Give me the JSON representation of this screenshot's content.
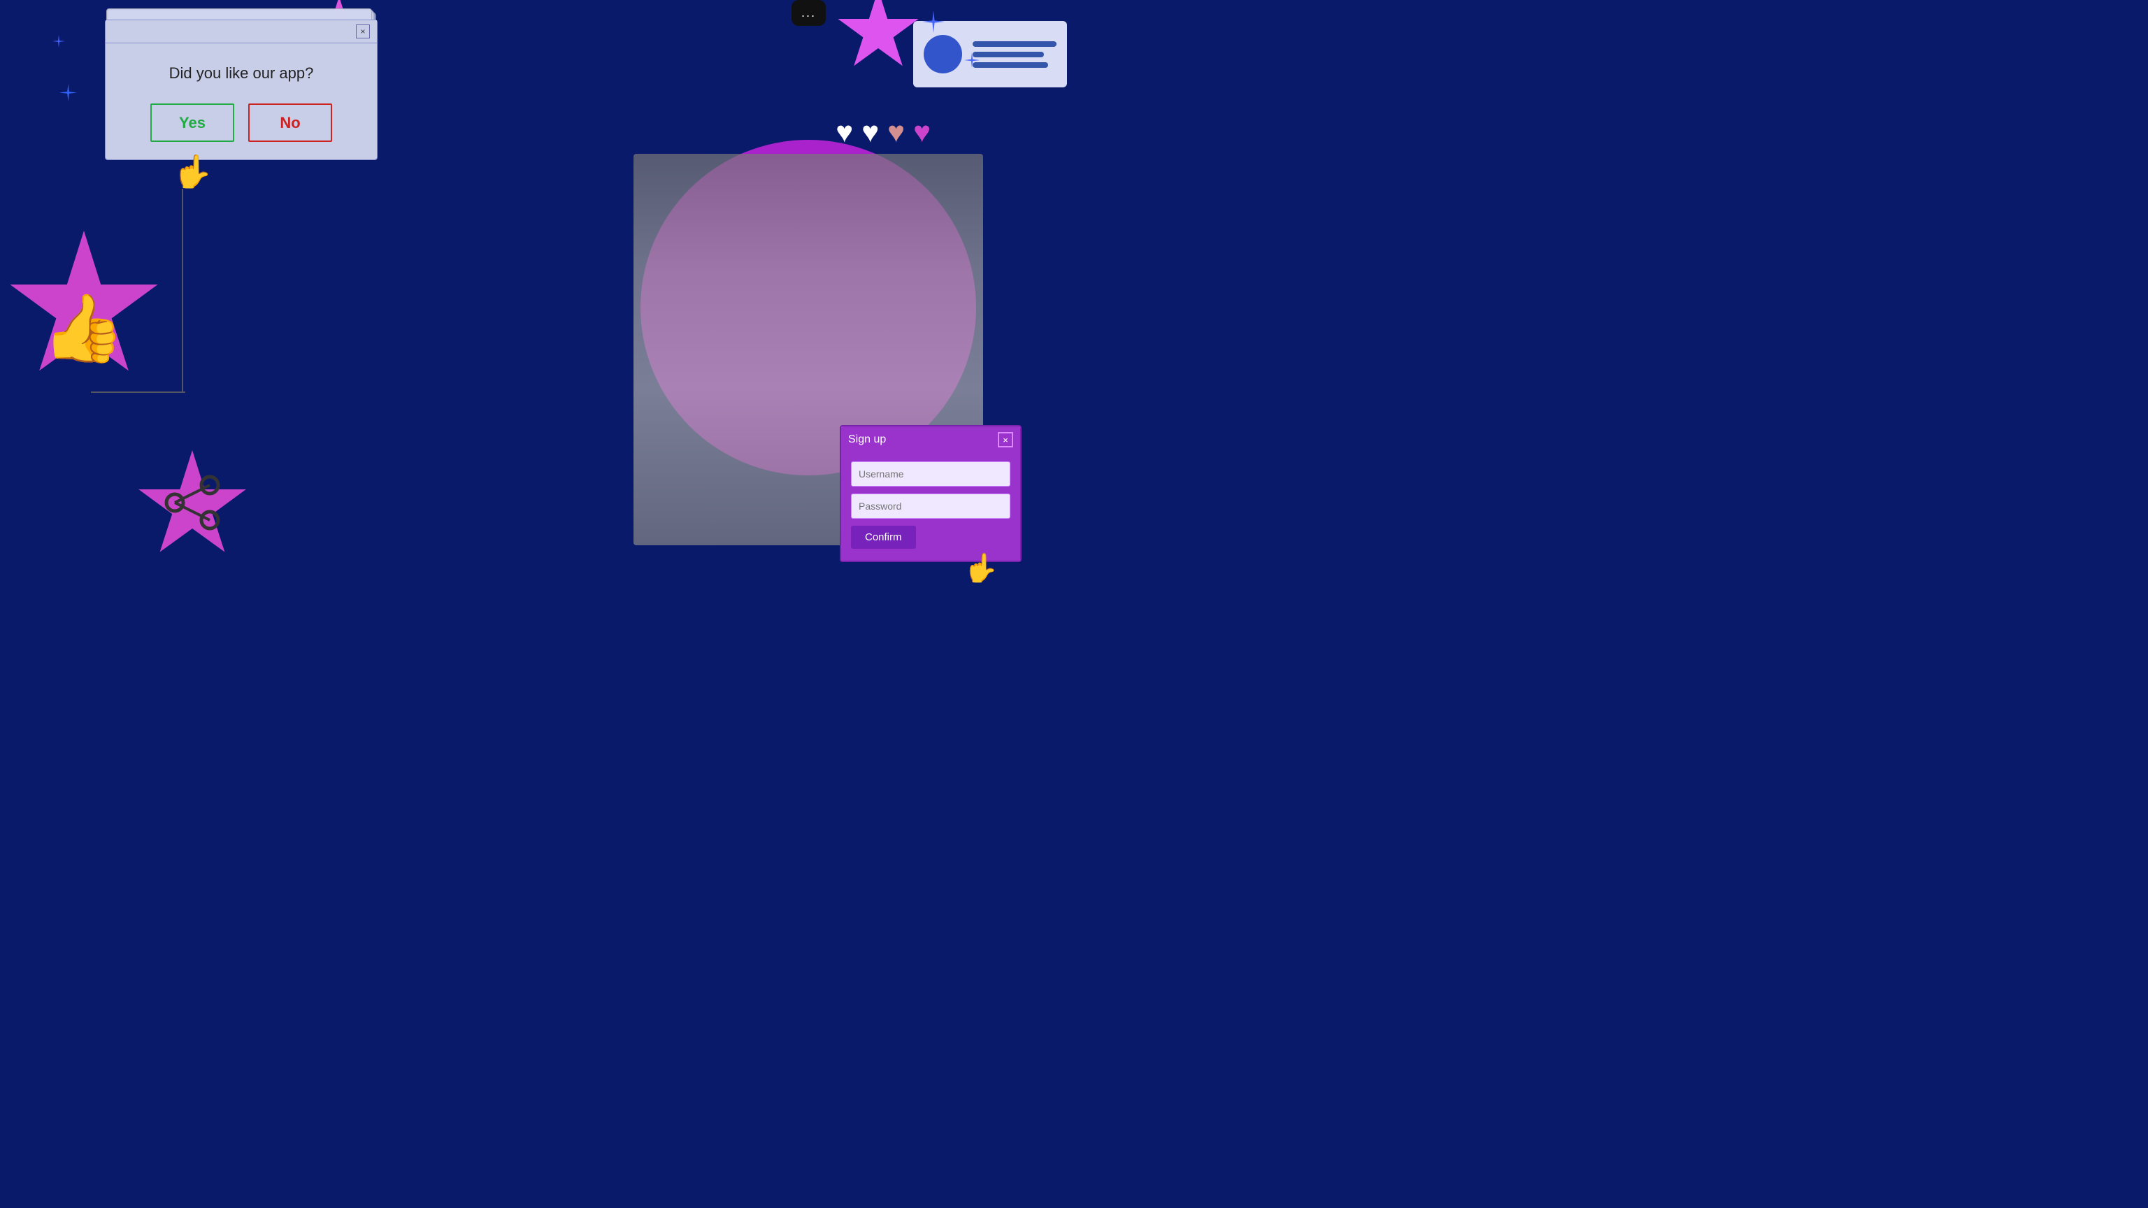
{
  "background": {
    "color": "#0a1a6b"
  },
  "main_dialog": {
    "title": "",
    "close_label": "×",
    "question": "Did you like our app?",
    "btn_yes": "Yes",
    "btn_no": "No"
  },
  "signup_dialog": {
    "title": "Sign up",
    "close_label": "×",
    "username_placeholder": "Username",
    "password_placeholder": "Password",
    "confirm_label": "Confirm"
  },
  "card": {
    "alt": "Profile card"
  },
  "decorative": {
    "thumbs_up": "👍",
    "cursor": "👆",
    "msg_dots": "..."
  }
}
